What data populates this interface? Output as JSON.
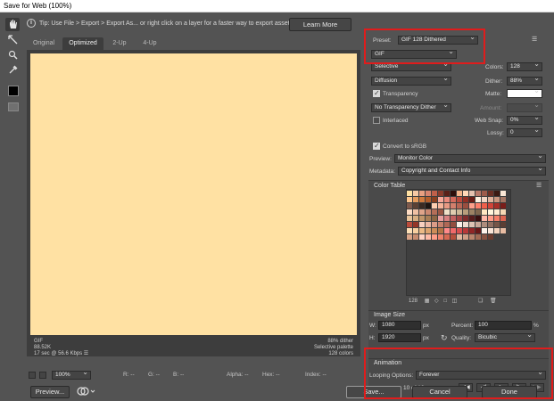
{
  "window": {
    "title": "Save for Web (100%)"
  },
  "tip": {
    "icon": "info-icon",
    "text": "Tip: Use File > Export > Export As...  or right click on a layer for a faster way to export assets",
    "learn_more": "Learn More"
  },
  "tabs": [
    {
      "label": "Original",
      "active": false
    },
    {
      "label": "Optimized",
      "active": true
    },
    {
      "label": "2-Up",
      "active": false
    },
    {
      "label": "4-Up",
      "active": false
    }
  ],
  "preview": {
    "fill_color": "#ffe1a3",
    "info_left": [
      "GIF",
      "88.52K",
      "17 sec @ 56.6 Kbps"
    ],
    "info_left_menu": "☰",
    "info_right": [
      "88% dither",
      "Selective palette",
      "128 colors"
    ]
  },
  "status": {
    "zoom": "100%",
    "r": "R: --",
    "g": "G: --",
    "b": "B: --",
    "alpha": "Alpha: --",
    "hex": "Hex: --",
    "index": "Index: --"
  },
  "footer_left": {
    "preview_btn": "Preview...",
    "browser_icon": "browser-icon"
  },
  "settings": {
    "preset_label": "Preset:",
    "preset_value": "GIF 128 Dithered",
    "format": "GIF",
    "reduction": "Selective",
    "colors_label": "Colors:",
    "colors_value": "128",
    "dither_algo": "Diffusion",
    "dither_label": "Dither:",
    "dither_value": "88%",
    "transparency_label": "Transparency",
    "transparency_checked": true,
    "matte_label": "Matte:",
    "trans_dither": "No Transparency Dither",
    "amount_label": "Amount:",
    "interlaced_label": "Interlaced",
    "interlaced_checked": false,
    "websnap_label": "Web Snap:",
    "websnap_value": "0%",
    "lossy_label": "Lossy:",
    "lossy_value": "0",
    "convert_srgb_label": "Convert to sRGB",
    "convert_srgb_checked": true,
    "preview_label": "Preview:",
    "preview_value": "Monitor Color",
    "metadata_label": "Metadata:",
    "metadata_value": "Copyright and Contact Info"
  },
  "color_table": {
    "title": "Color Table",
    "count": "128",
    "colors": [
      "#ffe1a3",
      "#f6c9a4",
      "#e8a082",
      "#d8846e",
      "#c0604a",
      "#8a3b2c",
      "#5a2018",
      "#2e0f0b",
      "#f3b48a",
      "#ffd8b8",
      "#e6c2b0",
      "#b97a6a",
      "#9c5a4a",
      "#6a2f24",
      "#3b1a12",
      "#fbe8d6",
      "#ffc78e",
      "#e49b5d",
      "#d07a3e",
      "#b35d2b",
      "#8a4020",
      "#f7a99a",
      "#ea8a7c",
      "#d46a5c",
      "#bb4a3c",
      "#922f24",
      "#6b1d16",
      "#fff1e0",
      "#f2d5c4",
      "#e0b39c",
      "#c99780",
      "#a57764",
      "#7f5a4c",
      "#5a4034",
      "#3a2a22",
      "#1f1612",
      "#ffcfb0",
      "#f7b59a",
      "#e89a84",
      "#d37f6c",
      "#b96655",
      "#9a4e3f",
      "#ff9f8a",
      "#ff7f6a",
      "#ef5f4a",
      "#d1443a",
      "#a82e28",
      "#7a1e1a",
      "#fddcc4",
      "#efc0a4",
      "#dfa48a",
      "#cc8870",
      "#b56e58",
      "#9b5644",
      "#f0e0c8",
      "#e0ccb0",
      "#cdb796",
      "#b89e7c",
      "#9d8264",
      "#80674e",
      "#ffe7c2",
      "#fff6dc",
      "#ffecd0",
      "#f5d8b4",
      "#e8c49a",
      "#d6ae82",
      "#c2966a",
      "#a97e56",
      "#8d6644",
      "#e9a0a0",
      "#d88080",
      "#c26060",
      "#a44444",
      "#7e2c2c",
      "#581c1c",
      "#3a1010",
      "#ffb8a8",
      "#ff9c88",
      "#f57e68",
      "#dd6450",
      "#bb4c3c",
      "#953628",
      "#f8d0c0",
      "#ecb8a4",
      "#dc9c88",
      "#c8826e",
      "#b06856",
      "#924e40",
      "#faf0e8",
      "#eedcd0",
      "#dec4b4",
      "#c8a898",
      "#ae8c7c",
      "#927062",
      "#765648",
      "#5a3e34",
      "#fde0b8",
      "#f7cfa0",
      "#ecba86",
      "#dea46e",
      "#cc8c58",
      "#b47446",
      "#ff8a8a",
      "#f06a6a",
      "#d84e4e",
      "#b83838",
      "#902626",
      "#6a1818",
      "#fff3ea",
      "#fbe6d8",
      "#f3d2bc",
      "#e8bca2",
      "#d9a488",
      "#c68c70",
      "#ffd2c2",
      "#ffbaa6",
      "#ff9e88",
      "#f0826c",
      "#d66852",
      "#b44f3c",
      "#e2b8a0",
      "#d09e86",
      "#ba846c",
      "#a26a54",
      "#885240",
      "#6c3c2e"
    ]
  },
  "image_size": {
    "title": "Image Size",
    "w_label": "W:",
    "w_value": "1080",
    "w_unit": "px",
    "h_label": "H:",
    "h_value": "1920",
    "h_unit": "px",
    "percent_label": "Percent:",
    "percent_value": "100",
    "percent_unit": "%",
    "quality_label": "Quality:",
    "quality_value": "Bicubic"
  },
  "animation": {
    "title": "Animation",
    "looping_label": "Looping Options:",
    "looping_value": "Forever",
    "frame_counter": "10 of 10"
  },
  "footer": {
    "save": "Save...",
    "cancel": "Cancel",
    "done": "Done"
  },
  "colors": {
    "highlight_box": "#e01c1c",
    "panel_bg": "#535353"
  }
}
